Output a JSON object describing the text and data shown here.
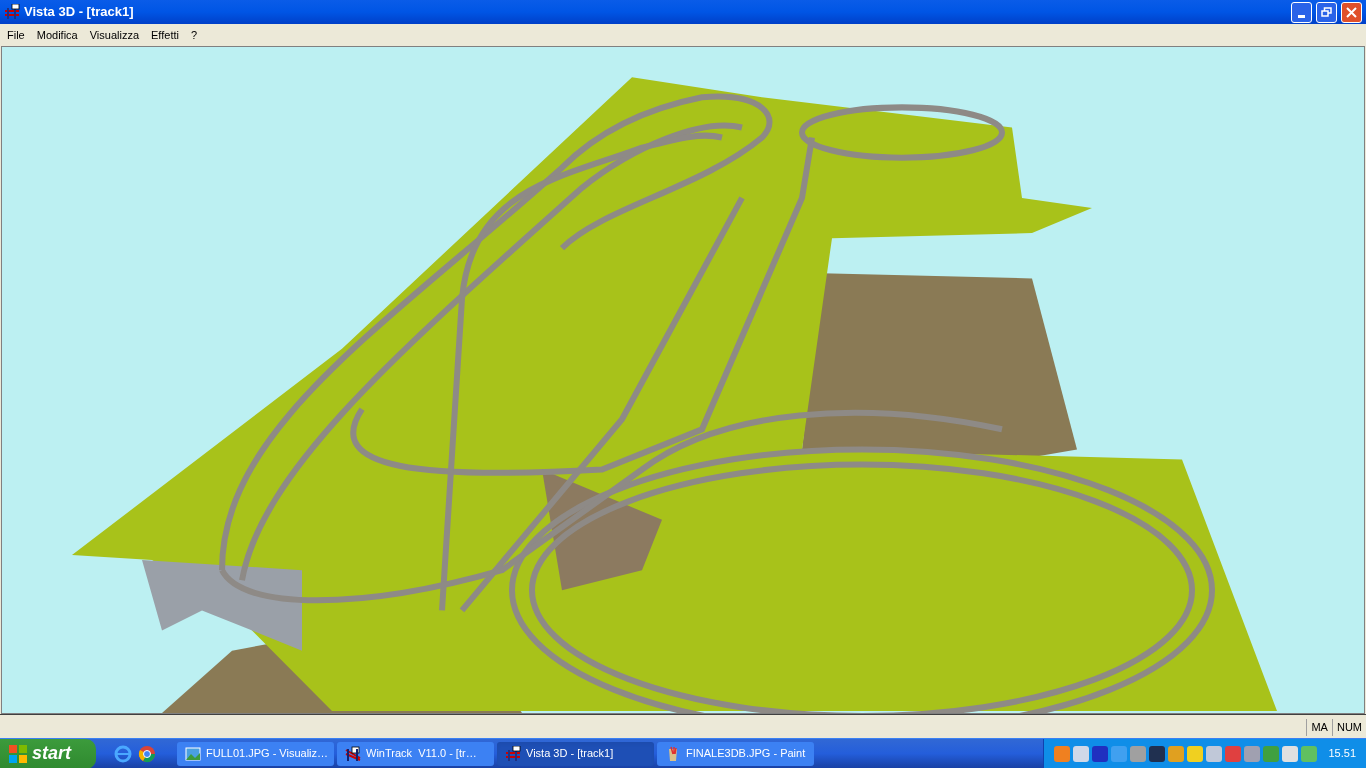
{
  "window": {
    "title": "Vista 3D - [track1]"
  },
  "menu": [
    "File",
    "Modifica",
    "Visualizza",
    "Effetti",
    "?"
  ],
  "status_bar": [
    "MA",
    "NUM"
  ],
  "taskbar": {
    "start": "start",
    "tasks": [
      {
        "label": "FULL01.JPG - Visualiz…",
        "kind": "image",
        "selected": false
      },
      {
        "label": "WinTrack  V11.0 - [tr…",
        "kind": "wintrack",
        "selected": false
      },
      {
        "label": "Vista 3D - [track1]",
        "kind": "vista",
        "selected": true
      },
      {
        "label": "FINALE3DB.JPG - Paint",
        "kind": "paint",
        "selected": false
      }
    ],
    "clock": "15.51"
  }
}
